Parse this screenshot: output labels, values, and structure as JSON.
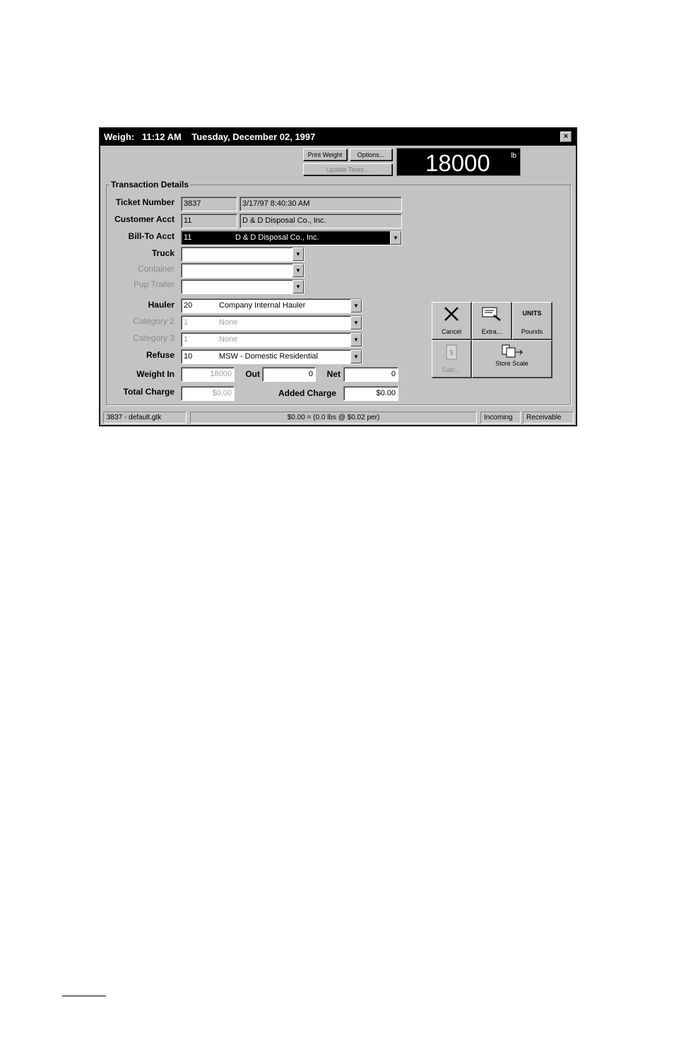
{
  "window": {
    "title": "Weigh:   11:12 AM    Tuesday, December 02, 1997",
    "close_glyph": "×"
  },
  "toolbar": {
    "print_weight": "Print Weight",
    "options": "Options...",
    "update_tares": "Update Tares..."
  },
  "weight_display": {
    "value": "18000",
    "unit": "lb"
  },
  "transaction": {
    "group_title": "Transaction Details",
    "ticket_number": {
      "label": "Ticket Number",
      "value": "3837",
      "datetime": "3/17/97 8:40:30 AM"
    },
    "customer_acct": {
      "label": "Customer Acct",
      "value": "11",
      "name": "D & D Disposal Co., Inc."
    },
    "bill_to_acct": {
      "label": "Bill-To Acct",
      "value": "11",
      "name": "D & D Disposal Co., Inc."
    },
    "truck": {
      "label": "Truck",
      "value": ""
    },
    "container": {
      "label": "Container",
      "value": ""
    },
    "pup_trailer": {
      "label": "Pup Trailer",
      "value": ""
    },
    "hauler": {
      "label": "Hauler",
      "code": "20",
      "name": "Company Internal Hauler"
    },
    "category2": {
      "label": "Category 2",
      "code": "1",
      "name": "None"
    },
    "category3": {
      "label": "Category 3",
      "code": "1",
      "name": "None"
    },
    "refuse": {
      "label": "Refuse",
      "code": "10",
      "name": "MSW - Domestic Residential"
    },
    "weight_in": {
      "label": "Weight In",
      "value": "18000"
    },
    "out": {
      "label": "Out",
      "value": "0"
    },
    "net": {
      "label": "Net",
      "value": "0"
    },
    "total_charge": {
      "label": "Total Charge",
      "value": "$0.00"
    },
    "added_charge": {
      "label": "Added Charge",
      "value": "$0.00"
    }
  },
  "actions": {
    "cancel": {
      "label": "Cancel",
      "icon": "cancel-x-icon"
    },
    "extra": {
      "label": "Extra...",
      "icon": "extra-icon"
    },
    "units": {
      "label": "Pounds",
      "icon_text": "UNITS"
    },
    "calc": {
      "label": "Calc...",
      "icon": "calc-icon"
    },
    "store_scale": {
      "label": "Store Scale",
      "icon": "store-scale-icon"
    }
  },
  "status_bar": {
    "file": "3837 - default.gtk",
    "summary": "$0.00 = (0.0 lbs @ $0.02 per)",
    "direction": "Incoming",
    "type": "Receivable"
  },
  "colors": {
    "window_bg": "#c3c3c3",
    "title_bg": "#000000",
    "display_bg": "#000000"
  }
}
